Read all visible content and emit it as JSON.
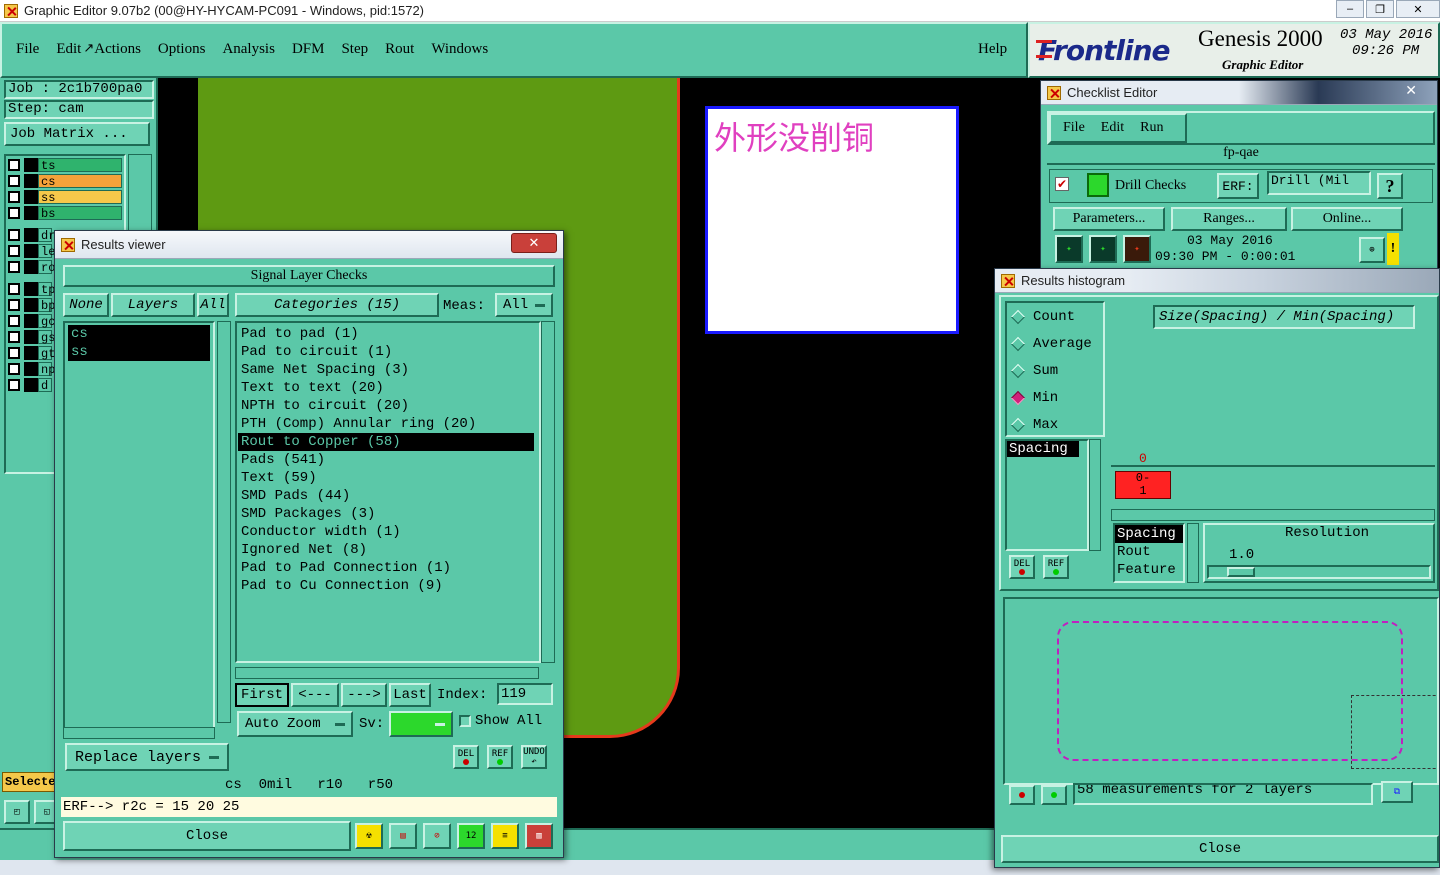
{
  "os_titlebar": {
    "title": "Graphic Editor 9.07b2 (00@HY-HYCAM-PC091 - Windows, pid:1572)",
    "buttons": [
      "–",
      "❐",
      "✕"
    ]
  },
  "menubar": {
    "items": [
      "File",
      "Edit",
      "Actions",
      "Options",
      "Analysis",
      "DFM",
      "Step",
      "Rout",
      "Windows"
    ],
    "help": "Help"
  },
  "brand": {
    "logo": "Frontline",
    "product": "Genesis 2000",
    "subtitle": "Graphic Editor",
    "date": "03 May 2016",
    "time": "09:26 PM"
  },
  "job_panel": {
    "job": "Job  : 2c1b700pa0",
    "step": "Step: cam",
    "job_matrix": "Job Matrix ...",
    "selected": "Selecte"
  },
  "layers": [
    {
      "name": "ts",
      "color": "#2fb36d"
    },
    {
      "name": "cs",
      "color": "#f5a23a"
    },
    {
      "name": "ss",
      "color": "#f5c84a"
    },
    {
      "name": "bs",
      "color": "#2fb36d"
    },
    {
      "name": "dr",
      "color": "#5bc8a8"
    },
    {
      "name": "le",
      "color": "#5bc8a8"
    },
    {
      "name": "ro",
      "color": "#5bc8a8"
    },
    {
      "name": "tp",
      "color": "#5bc8a8"
    },
    {
      "name": "bp",
      "color": "#5bc8a8"
    },
    {
      "name": "gc",
      "color": "#5bc8a8"
    },
    {
      "name": "gs",
      "color": "#5bc8a8"
    },
    {
      "name": "gt",
      "color": "#5bc8a8"
    },
    {
      "name": "np",
      "color": "#5bc8a8"
    },
    {
      "name": "d",
      "color": "#5bc8a8"
    }
  ],
  "canvas": {
    "note_text": "外形没削铜"
  },
  "results_viewer": {
    "title": "Results viewer",
    "header": "Signal Layer Checks",
    "none_btn": "None",
    "layers_btn": "Layers",
    "all_btn": "All",
    "categories_label": "Categories (15)",
    "meas_label": "Meas:",
    "meas_value": "All",
    "layer_list": [
      "cs",
      "ss"
    ],
    "categories": [
      "Pad to pad (1)",
      "Pad to circuit (1)",
      "Same Net Spacing (3)",
      "Text to text (20)",
      "NPTH to circuit (20)",
      "PTH (Comp) Annular ring (20)",
      "Rout to Copper (58)",
      "Pads (541)",
      "Text (59)",
      "SMD Pads (44)",
      "SMD Packages (3)",
      "Conductor width (1)",
      "Ignored Net (8)",
      "Pad to Pad Connection (1)",
      "Pad to Cu Connection (9)"
    ],
    "selected_category_index": 6,
    "first_btn": "First",
    "prev_btn": "<---",
    "next_btn": "--->",
    "last_btn": "Last",
    "index_label": "Index:",
    "index_value": "119",
    "auto_zoom": "Auto Zoom",
    "sv_label": "Sv:",
    "show_all": "Show All",
    "replace_layers": "Replace layers",
    "del_btn": "DEL",
    "ref_btn": "REF",
    "undo_btn": "UNDO",
    "status_line": "cs  0mil   r10   r50",
    "erf_line": "ERF--> r2c = 15 20 25",
    "close": "Close"
  },
  "checklist_editor": {
    "title": "Checklist Editor",
    "menu": [
      "File",
      "Edit",
      "Run"
    ],
    "name": "fp-qae",
    "check_name": "Drill Checks",
    "erf_label": "ERF:",
    "erf_value": "Drill (Mil",
    "help": "?",
    "parameters": "Parameters...",
    "ranges": "Ranges...",
    "online": "Online...",
    "run_date": "03 May 2016",
    "run_time": "09:30 PM - 0:00:01",
    "warn": "!"
  },
  "histogram": {
    "title": "Results histogram",
    "modes": [
      "Count",
      "Average",
      "Sum",
      "Min",
      "Max"
    ],
    "selected_mode": "Min",
    "expr": "Size(Spacing) / Min(Spacing)",
    "list_item": "Spacing",
    "bar_top": "0",
    "bar_label": "0-\n1",
    "fields": [
      "Spacing",
      "Rout",
      "Feature"
    ],
    "resolution_label": "Resolution",
    "resolution_value": "1.0",
    "del_btn": "DEL",
    "ref_btn": "REF",
    "measurements": "58 measurements for 2 layers",
    "close": "Close"
  }
}
